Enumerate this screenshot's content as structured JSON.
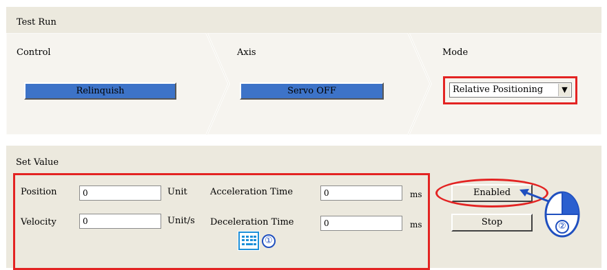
{
  "test_run": {
    "title": "Test Run",
    "control": {
      "label": "Control",
      "button": "Relinquish"
    },
    "axis": {
      "label": "Axis",
      "button": "Servo OFF"
    },
    "mode": {
      "label": "Mode",
      "selected": "Relative Positioning"
    }
  },
  "set_value": {
    "title": "Set Value",
    "position": {
      "label": "Position",
      "value": "0",
      "unit": "Unit"
    },
    "velocity": {
      "label": "Velocity",
      "value": "0",
      "unit": "Unit/s"
    },
    "acceleration": {
      "label": "Acceleration Time",
      "value": "0",
      "unit": "ms"
    },
    "deceleration": {
      "label": "Deceleration Time",
      "value": "0",
      "unit": "ms"
    },
    "enabled_button": "Enabled",
    "stop_button": "Stop"
  },
  "annotations": {
    "step1": "①",
    "step2": "②",
    "highlight_color": "#e32322",
    "callout_color": "#1f4fbf",
    "step1_icon": "keyboard-icon",
    "step2_icon": "mouse-icon"
  }
}
